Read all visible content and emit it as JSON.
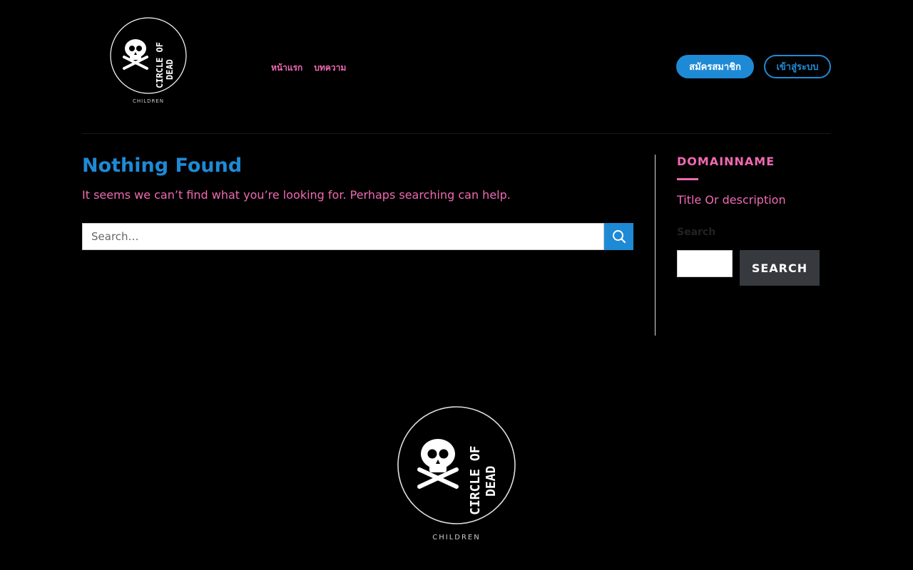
{
  "brand": {
    "logo_text_line1": "CIRCLE OF",
    "logo_text_line2": "DEAD",
    "logo_subtext": "CHILDREN"
  },
  "nav": {
    "items": [
      {
        "label": "หน้าแรก"
      },
      {
        "label": "บทความ"
      }
    ]
  },
  "header": {
    "register_label": "สมัครสมาชิก",
    "login_label": "เข้าสู่ระบบ"
  },
  "main": {
    "title": "Nothing Found",
    "description": "It seems we can’t find what you’re looking for. Perhaps searching can help.",
    "search_placeholder": "Search…",
    "search_icon": "search-icon"
  },
  "sidebar": {
    "widget_title": "DOMAINNAME",
    "widget_description": "Title Or description",
    "search_label": "Search",
    "search_button": "SEARCH"
  },
  "colors": {
    "background": "#000000",
    "accent_blue": "#1e8ad6",
    "accent_pink": "#f06ab3",
    "dark_button": "#363a3e"
  }
}
